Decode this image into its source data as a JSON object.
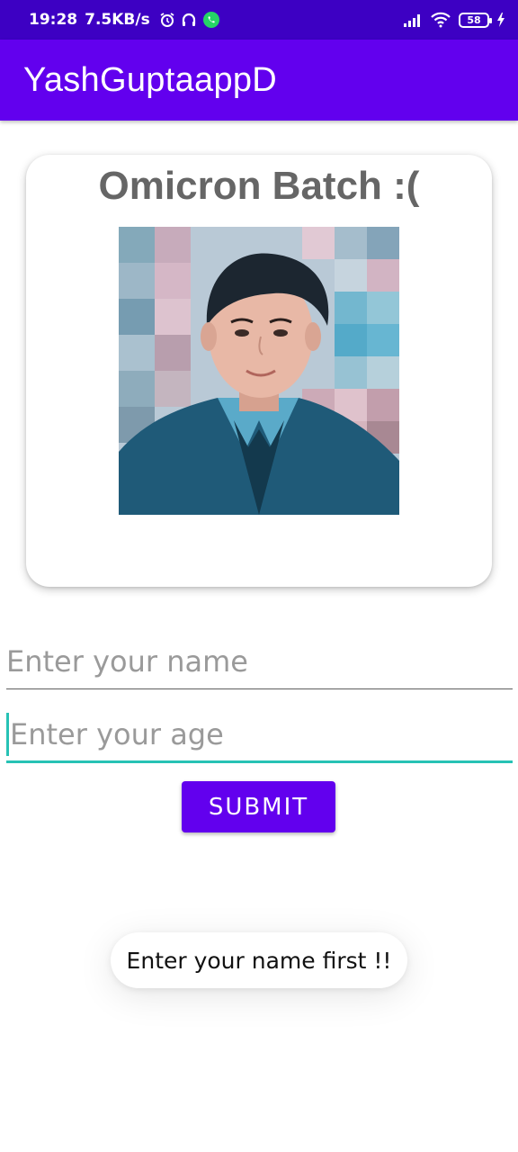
{
  "status_bar": {
    "time": "19:28",
    "net_speed": "7.5KB/s",
    "battery_level": "58",
    "icons": [
      "alarm-icon",
      "headphones-icon",
      "whatsapp-icon",
      "signal-icon",
      "wifi-icon",
      "battery-icon",
      "charging-icon"
    ]
  },
  "app_bar": {
    "title": "YashGuptaappD"
  },
  "card": {
    "title": "Omicron Batch :("
  },
  "form": {
    "name_placeholder": "Enter your name",
    "age_placeholder": "Enter your age",
    "submit_label": "SUBMIT"
  },
  "toast": {
    "message": "Enter your name first !!"
  },
  "colors": {
    "status_bar": "#3d00c3",
    "app_bar": "#6200ee",
    "button": "#6200ee",
    "focused_underline": "#27c2b5",
    "title_text": "#666666"
  }
}
